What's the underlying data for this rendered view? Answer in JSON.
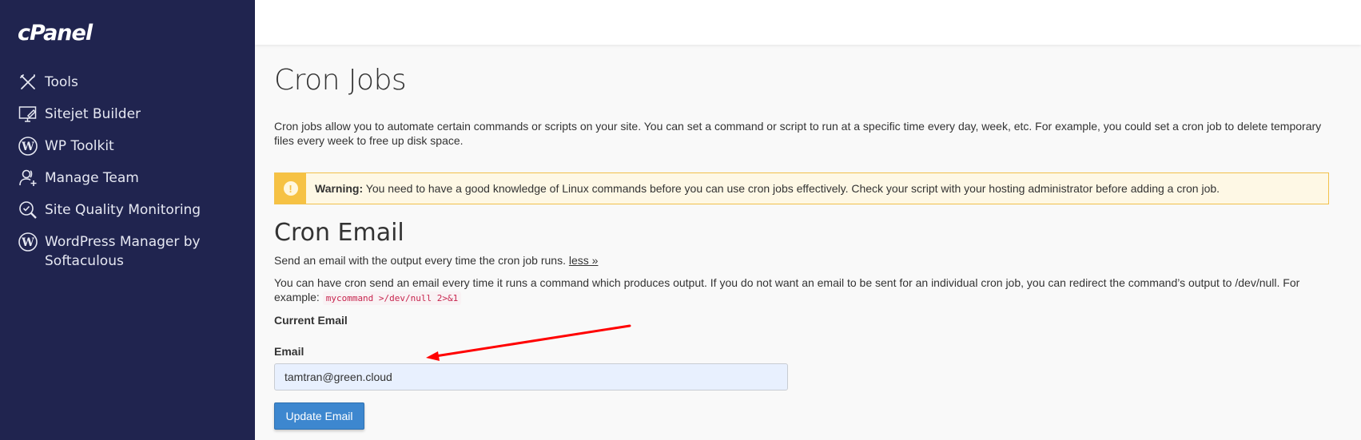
{
  "sidebar": {
    "logo": "cPanel",
    "items": [
      {
        "label": "Tools",
        "icon": "tools-icon"
      },
      {
        "label": "Sitejet Builder",
        "icon": "monitor-pen-icon"
      },
      {
        "label": "WP Toolkit",
        "icon": "wordpress-icon"
      },
      {
        "label": "Manage Team",
        "icon": "user-plus-icon"
      },
      {
        "label": "Site Quality Monitoring",
        "icon": "magnifier-check-icon"
      },
      {
        "label": "WordPress Manager by Softaculous",
        "icon": "wordpress-icon"
      }
    ]
  },
  "main": {
    "title": "Cron Jobs",
    "intro": "Cron jobs allow you to automate certain commands or scripts on your site. You can set a command or script to run at a specific time every day, week, etc. For example, you could set a cron job to delete temporary files every week to free up disk space.",
    "warning": {
      "icon": "exclamation-icon",
      "label": "Warning:",
      "text": " You need to have a good knowledge of Linux commands before you can use cron jobs effectively. Check your script with your hosting administrator before adding a cron job.",
      "colors": {
        "background": "#fef8e5",
        "border": "#f2c14a",
        "badge": "#f6c244"
      }
    },
    "cron_email": {
      "title": "Cron Email",
      "subtitle": "Send an email with the output every time the cron job runs. ",
      "less_link": "less »",
      "description": "You can have cron send an email every time it runs a command which produces output. If you do not want an email to be sent for an individual cron job, you can redirect the command’s output to /dev/null. For example: ",
      "example_code": "mycommand >/dev/null 2>&1",
      "current_email_label": "Current Email",
      "email_label": "Email",
      "email_value": "tamtran@green.cloud",
      "button_label": "Update Email",
      "button_color": "#3d87cf"
    },
    "annotation": {
      "type": "arrow",
      "color": "#ff0000",
      "points_to": "email-label"
    }
  }
}
